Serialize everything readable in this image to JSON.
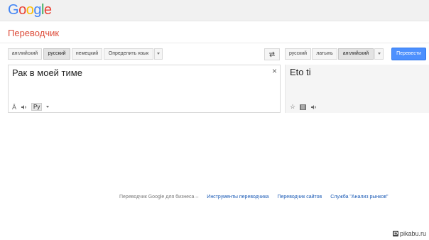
{
  "logo": {
    "letters": [
      "G",
      "o",
      "o",
      "g",
      "l",
      "e"
    ],
    "colors": [
      "#4285f4",
      "#ea4335",
      "#fbbc05",
      "#4285f4",
      "#34a853",
      "#ea4335"
    ]
  },
  "app": {
    "title": "Переводчик"
  },
  "source_langs": [
    "английский",
    "русский",
    "немецкий",
    "Определить язык"
  ],
  "target_langs": [
    "русский",
    "латынь",
    "английский"
  ],
  "translate_button": "Перевести",
  "source": {
    "text": "Рак в моей тиме",
    "clear": "×",
    "ime_label": "Ру"
  },
  "target": {
    "text": "Eto ti"
  },
  "footer": {
    "prefix": "Переводчик Google для бизнеса –",
    "links": [
      "Инструменты переводчика",
      "Переводчик сайтов",
      "Служба \"Анализ рынков\""
    ]
  },
  "watermark": "pikabu.ru"
}
